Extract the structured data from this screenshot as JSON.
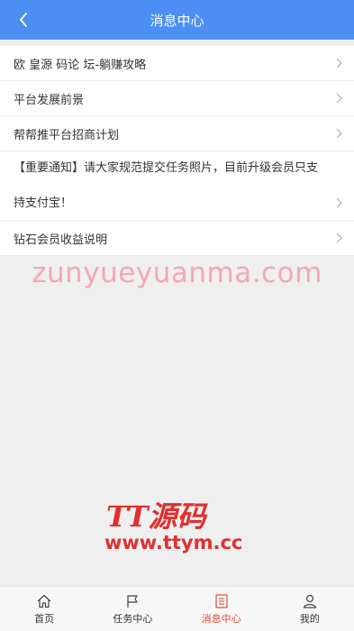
{
  "header": {
    "title": "消息中心"
  },
  "messages": [
    {
      "label": "欧 皇源 码论 坛-躺赚攻略"
    },
    {
      "label": "平台发展前景"
    },
    {
      "label": "帮帮推平台招商计划"
    },
    {
      "label": "【重要通知】请大家规范提交任务照片，目前升级会员只支持支付宝！"
    },
    {
      "label": "钻石会员收益说明"
    }
  ],
  "watermark": {
    "text": "zunyueyuanma.com"
  },
  "logo": {
    "line1": "TT源码",
    "line2": "www.ttym.cc"
  },
  "tabbar": {
    "tabs": [
      {
        "label": "首页",
        "icon": "home-icon"
      },
      {
        "label": "任务中心",
        "icon": "flag-icon"
      },
      {
        "label": "消息中心",
        "icon": "document-icon",
        "active": true
      },
      {
        "label": "我的",
        "icon": "user-icon"
      }
    ]
  },
  "colors": {
    "header": "#4c8ff4",
    "active": "#e2493a",
    "watermark": "#f4a7b3",
    "logo": "#e03030"
  }
}
